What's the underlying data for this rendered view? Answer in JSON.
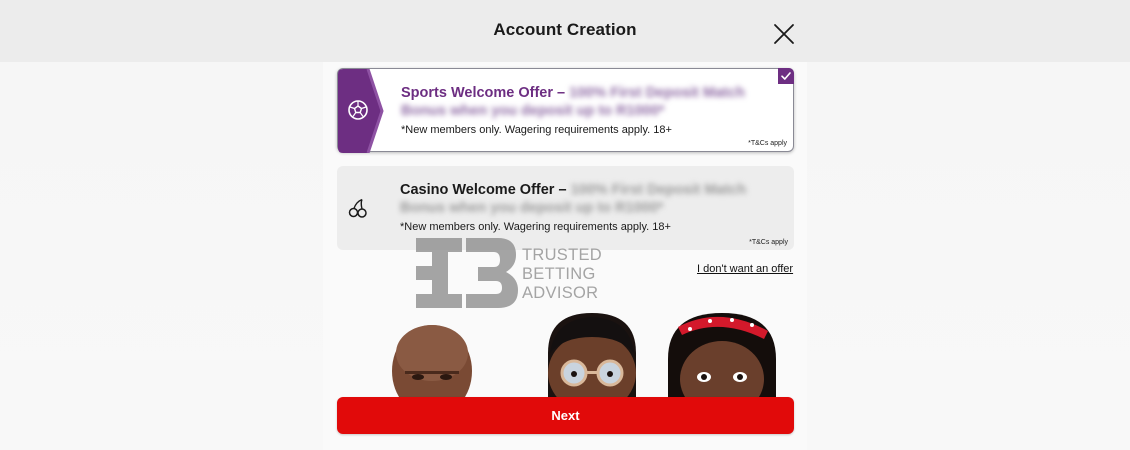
{
  "header": {
    "title": "Account Creation",
    "close_icon": "close-icon"
  },
  "offers": [
    {
      "title": "Sports Welcome Offer –",
      "details": "100% First Deposit Match Bonus when you deposit up to R1000*",
      "note": "*New members only. Wagering requirements apply. 18+",
      "tcs": "*T&Cs apply",
      "icon": "soccer-ball-icon",
      "selected": true
    },
    {
      "title": "Casino Welcome Offer –",
      "details": "100% First Deposit Match Bonus when you deposit up to R1000*",
      "note": "*New members only. Wagering requirements apply. 18+",
      "tcs": "*T&Cs apply",
      "icon": "cherries-icon",
      "selected": false
    }
  ],
  "no_offer_link": "I don't want an offer",
  "watermark": {
    "lines": [
      "TRUSTED",
      "BETTING",
      "ADVISOR"
    ]
  },
  "next_button": "Next",
  "colors": {
    "accent_purple": "#6d2e82",
    "cta_red": "#e10a0a",
    "header_bg": "#ececec"
  }
}
